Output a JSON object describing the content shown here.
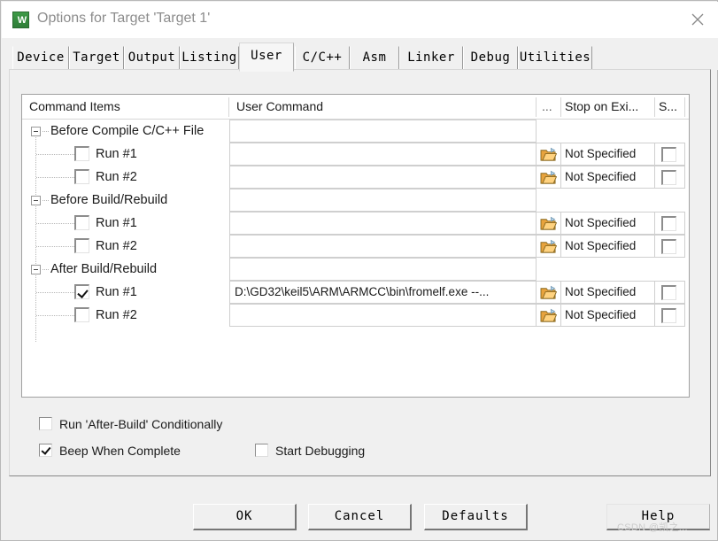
{
  "window": {
    "title": "Options for Target 'Target 1'",
    "app_icon": "keil-uvision-icon",
    "close_icon": "close-icon"
  },
  "tabs": [
    {
      "label": "Device",
      "selected": false
    },
    {
      "label": "Target",
      "selected": false
    },
    {
      "label": "Output",
      "selected": false
    },
    {
      "label": "Listing",
      "selected": false
    },
    {
      "label": "User",
      "selected": true
    },
    {
      "label": "C/C++",
      "selected": false
    },
    {
      "label": "Asm",
      "selected": false
    },
    {
      "label": "Linker",
      "selected": false
    },
    {
      "label": "Debug",
      "selected": false
    },
    {
      "label": "Utilities",
      "selected": false
    }
  ],
  "grid": {
    "headers": {
      "command_items": "Command Items",
      "user_command": "User Command",
      "dots": "...",
      "stop_on_exit": "Stop on Exi...",
      "s": "S..."
    },
    "rows": [
      {
        "type": "group",
        "label": "Before Compile C/C++ File",
        "expander": "collapse-expander-icon"
      },
      {
        "type": "item",
        "label": "Run #1",
        "checked": false,
        "user_command": "",
        "browse_icon": "folder-open-icon",
        "stop_on_exit": "Not Specified",
        "s_checked": false
      },
      {
        "type": "item",
        "label": "Run #2",
        "checked": false,
        "user_command": "",
        "browse_icon": "folder-open-icon",
        "stop_on_exit": "Not Specified",
        "s_checked": false
      },
      {
        "type": "group",
        "label": "Before Build/Rebuild",
        "expander": "collapse-expander-icon"
      },
      {
        "type": "item",
        "label": "Run #1",
        "checked": false,
        "user_command": "",
        "browse_icon": "folder-open-icon",
        "stop_on_exit": "Not Specified",
        "s_checked": false
      },
      {
        "type": "item",
        "label": "Run #2",
        "checked": false,
        "user_command": "",
        "browse_icon": "folder-open-icon",
        "stop_on_exit": "Not Specified",
        "s_checked": false
      },
      {
        "type": "group",
        "label": "After Build/Rebuild",
        "expander": "collapse-expander-icon"
      },
      {
        "type": "item",
        "label": "Run #1",
        "checked": true,
        "user_command": "D:\\GD32\\keil5\\ARM\\ARMCC\\bin\\fromelf.exe --...",
        "browse_icon": "folder-open-icon",
        "stop_on_exit": "Not Specified",
        "s_checked": false
      },
      {
        "type": "item",
        "label": "Run #2",
        "checked": false,
        "user_command": "",
        "browse_icon": "folder-open-icon",
        "stop_on_exit": "Not Specified",
        "s_checked": false
      }
    ]
  },
  "options": [
    {
      "label": "Run 'After-Build' Conditionally",
      "checked": false
    },
    {
      "label": "Beep When Complete",
      "checked": true
    },
    {
      "label": "Start Debugging",
      "checked": false
    }
  ],
  "buttons": {
    "ok": "OK",
    "cancel": "Cancel",
    "defaults": "Defaults",
    "help": "Help"
  },
  "watermark": "CSDN @凯之..."
}
